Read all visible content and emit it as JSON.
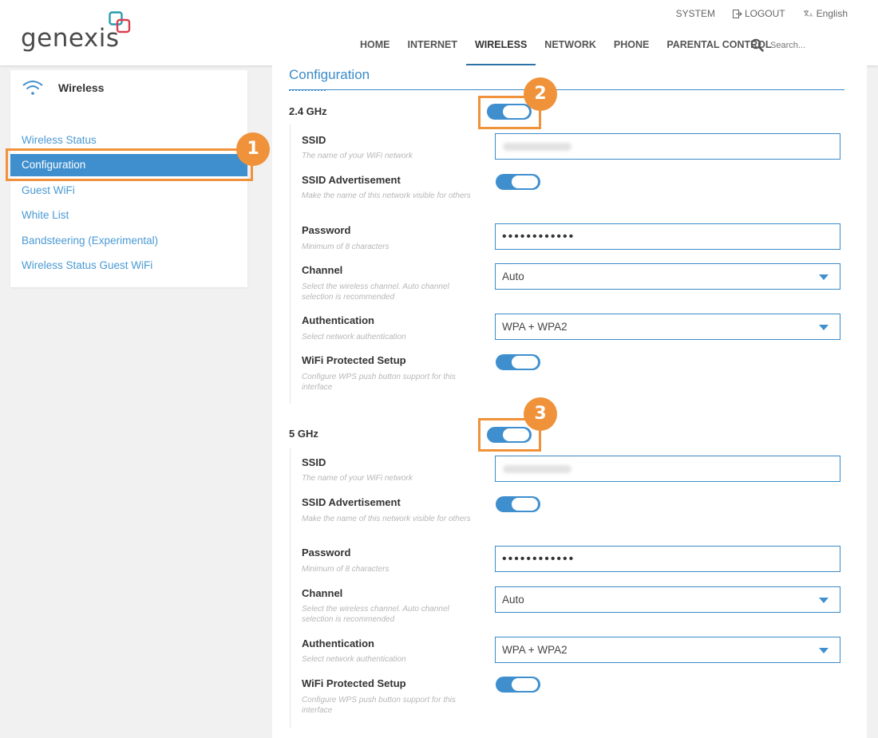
{
  "brand": {
    "logo_text": "genexis"
  },
  "top_links": {
    "system": "SYSTEM",
    "logout": "LOGOUT",
    "language": "English"
  },
  "nav": [
    {
      "label": "HOME"
    },
    {
      "label": "INTERNET"
    },
    {
      "label": "WIRELESS",
      "active": true
    },
    {
      "label": "NETWORK"
    },
    {
      "label": "PHONE"
    },
    {
      "label": "PARENTAL CONTROL"
    }
  ],
  "search": {
    "placeholder": "Search..."
  },
  "sidebar": {
    "title": "Wireless",
    "items": [
      {
        "label": "Wireless Status"
      },
      {
        "label": "Configuration",
        "active": true
      },
      {
        "label": "Guest WiFi"
      },
      {
        "label": "White List"
      },
      {
        "label": "Bandsteering (Experimental)"
      },
      {
        "label": "Wireless Status Guest WiFi"
      }
    ]
  },
  "page": {
    "title": "Configuration"
  },
  "bands": [
    {
      "name": "2.4 GHz",
      "enabled": true,
      "ssid": {
        "label": "SSID",
        "help": "The name of your WiFi network",
        "value": ""
      },
      "ssid_adv": {
        "label": "SSID Advertisement",
        "help": "Make the name of this network visible for others",
        "enabled": true
      },
      "password": {
        "label": "Password",
        "help": "Minimum of 8 characters",
        "value": "••••••••••••"
      },
      "channel": {
        "label": "Channel",
        "help": "Select the wireless channel. Auto channel selection is recommended",
        "value": "Auto"
      },
      "auth": {
        "label": "Authentication",
        "help": "Select network authentication",
        "value": "WPA + WPA2"
      },
      "wps": {
        "label": "WiFi Protected Setup",
        "help": "Configure WPS push button support for this interface",
        "enabled": true
      }
    },
    {
      "name": "5 GHz",
      "enabled": true,
      "ssid": {
        "label": "SSID",
        "help": "The name of your WiFi network",
        "value": ""
      },
      "ssid_adv": {
        "label": "SSID Advertisement",
        "help": "Make the name of this network visible for others",
        "enabled": true
      },
      "password": {
        "label": "Password",
        "help": "Minimum of 8 characters",
        "value": "••••••••••••"
      },
      "channel": {
        "label": "Channel",
        "help": "Select the wireless channel. Auto channel selection is recommended",
        "value": "Auto"
      },
      "auth": {
        "label": "Authentication",
        "help": "Select network authentication",
        "value": "WPA + WPA2"
      },
      "wps": {
        "label": "WiFi Protected Setup",
        "help": "Configure WPS push button support for this interface",
        "enabled": true
      }
    }
  ],
  "annotations": {
    "step1": "1",
    "step2": "2",
    "step3": "3"
  },
  "colors": {
    "accent": "#3f8fce",
    "highlight": "#f0923a"
  }
}
